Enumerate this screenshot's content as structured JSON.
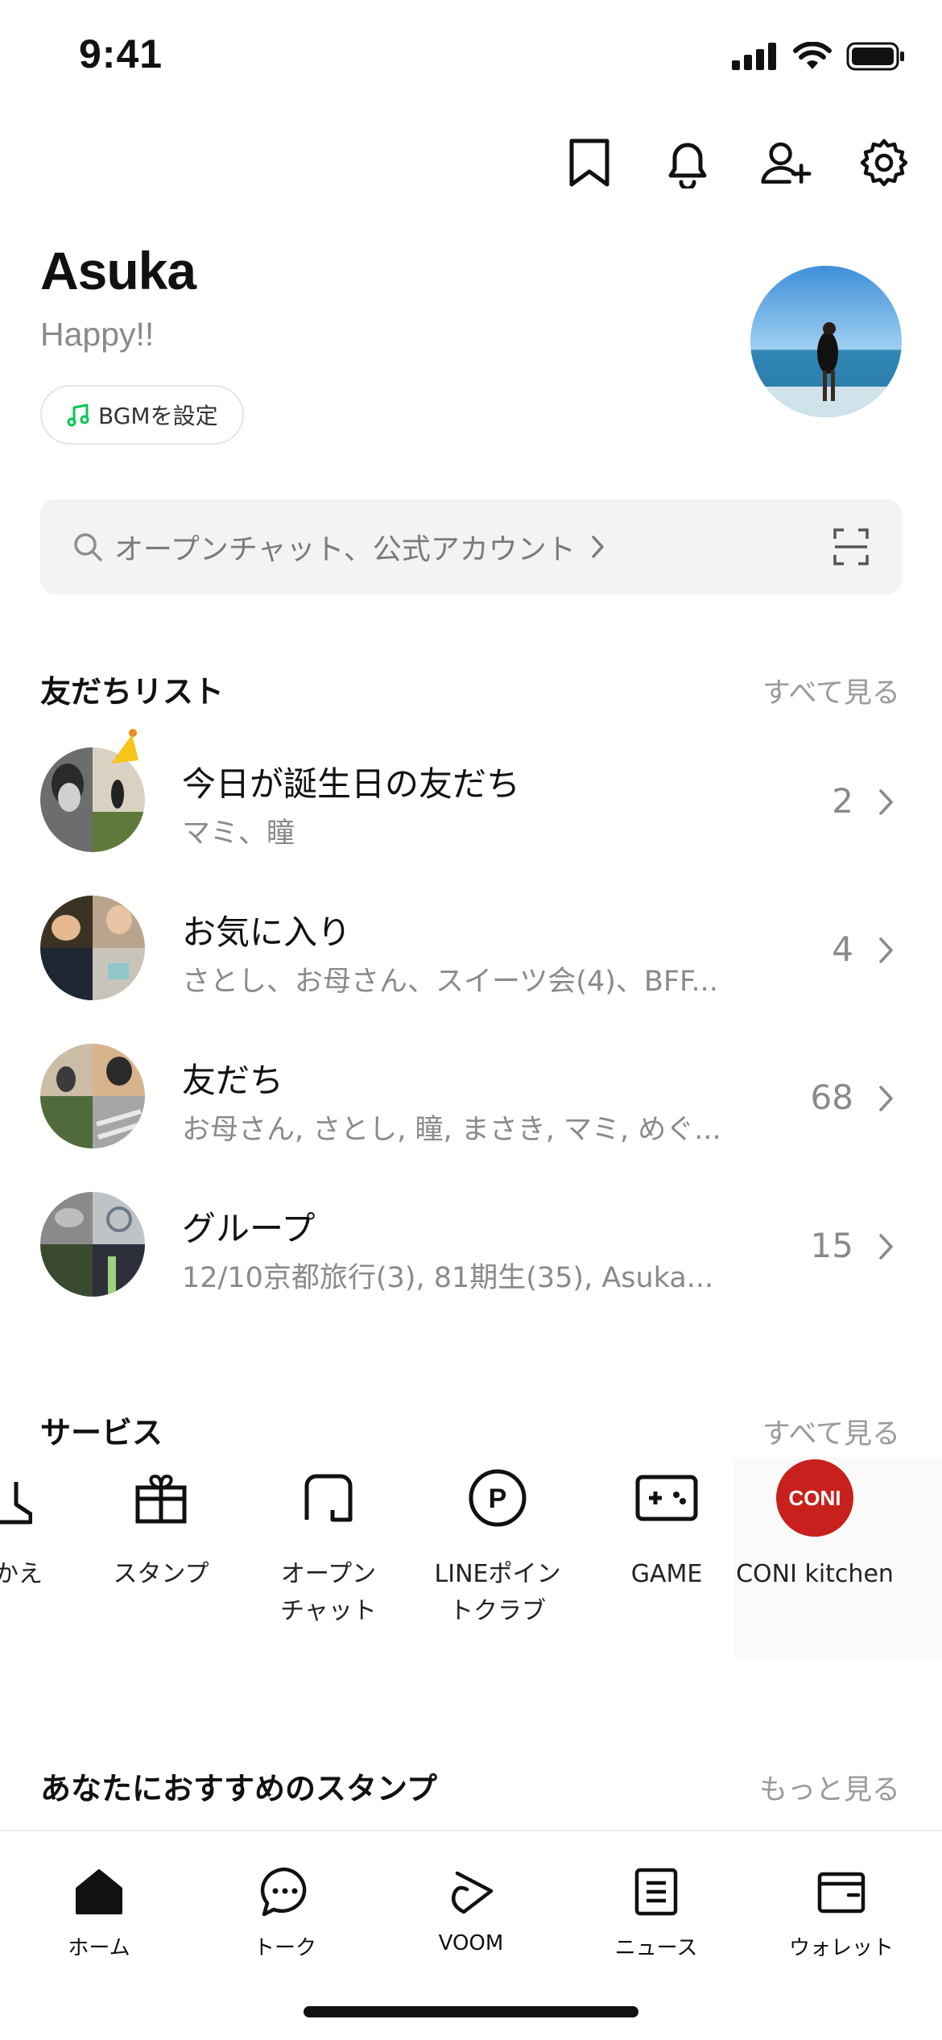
{
  "status_bar": {
    "time": "9:41"
  },
  "profile": {
    "name": "Asuka",
    "status_message": "Happy!!",
    "bgm_label": "BGMを設定"
  },
  "search": {
    "placeholder": "オープンチャット、公式アカウント"
  },
  "friends": {
    "title": "友だちリスト",
    "see_all": "すべて見る",
    "rows": [
      {
        "title": "今日が誕生日の友だち",
        "subtitle": "マミ、瞳",
        "count": "2"
      },
      {
        "title": "お気に入り",
        "subtitle": "さとし、お母さん、スイーツ会(4)、BFF...",
        "count": "4"
      },
      {
        "title": "友だち",
        "subtitle": "お母さん, さとし, 瞳, まさき, マミ, めぐ...",
        "count": "68"
      },
      {
        "title": "グループ",
        "subtitle": "12/10京都旅行(3), 81期生(35), Asuka...",
        "count": "15"
      }
    ]
  },
  "services": {
    "title": "サービス",
    "see_all": "すべて見る",
    "items": [
      {
        "label": "かえ",
        "icon": "partial-icon"
      },
      {
        "label": "スタンプ",
        "icon": "gift-icon"
      },
      {
        "label_line1": "オープン",
        "label_line2": "チャット",
        "icon": "openchat-icon"
      },
      {
        "label_line1": "LINEポイン",
        "label_line2": "トクラブ",
        "icon": "points-icon"
      },
      {
        "label": "GAME",
        "icon": "game-controller-icon"
      },
      {
        "label": "CONI kitchen",
        "logo_text": "CONI",
        "icon": "coni-logo"
      }
    ]
  },
  "recommended": {
    "title": "あなたにおすすめのスタンプ",
    "see_more": "もっと見る"
  },
  "tab_bar": {
    "tabs": [
      {
        "label": "ホーム",
        "icon": "home-icon"
      },
      {
        "label": "トーク",
        "icon": "chat-icon"
      },
      {
        "label": "VOOM",
        "icon": "voom-icon"
      },
      {
        "label": "ニュース",
        "icon": "news-icon"
      },
      {
        "label": "ウォレット",
        "icon": "wallet-icon"
      }
    ]
  },
  "colors": {
    "accent_green": "#06c755",
    "coni_red": "#c8201c",
    "muted_text": "#8a8a8a"
  }
}
